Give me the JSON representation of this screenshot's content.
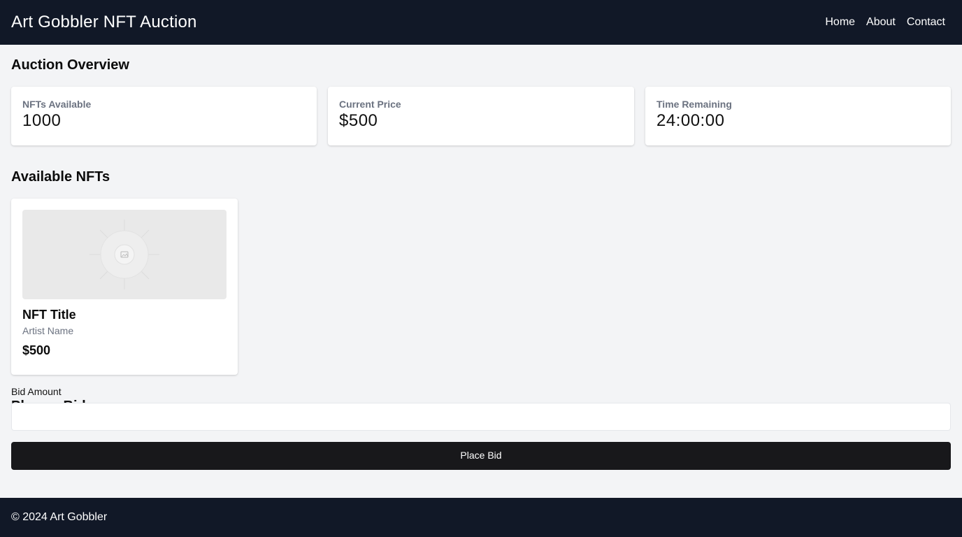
{
  "header": {
    "title": "Art Gobbler NFT Auction",
    "nav": [
      "Home",
      "About",
      "Contact"
    ]
  },
  "overview": {
    "heading": "Auction Overview",
    "stats": [
      {
        "label": "NFTs Available",
        "value": "1000"
      },
      {
        "label": "Current Price",
        "value": "$500"
      },
      {
        "label": "Time Remaining",
        "value": "24:00:00"
      }
    ]
  },
  "available": {
    "heading": "Available NFTs",
    "items": [
      {
        "image_icon": "image-placeholder-icon",
        "title": "NFT Title",
        "artist": "Artist Name",
        "price": "$500"
      }
    ]
  },
  "bid": {
    "heading": "Place a Bid",
    "label": "Bid Amount",
    "input_value": "",
    "placeholder": "",
    "button_label": "Place Bid"
  },
  "footer": {
    "text": "© 2024 Art Gobbler"
  },
  "colors": {
    "header_bg": "#111827",
    "page_bg": "#f3f4f6",
    "button_bg": "#18181b",
    "muted_text": "#6b7280"
  }
}
